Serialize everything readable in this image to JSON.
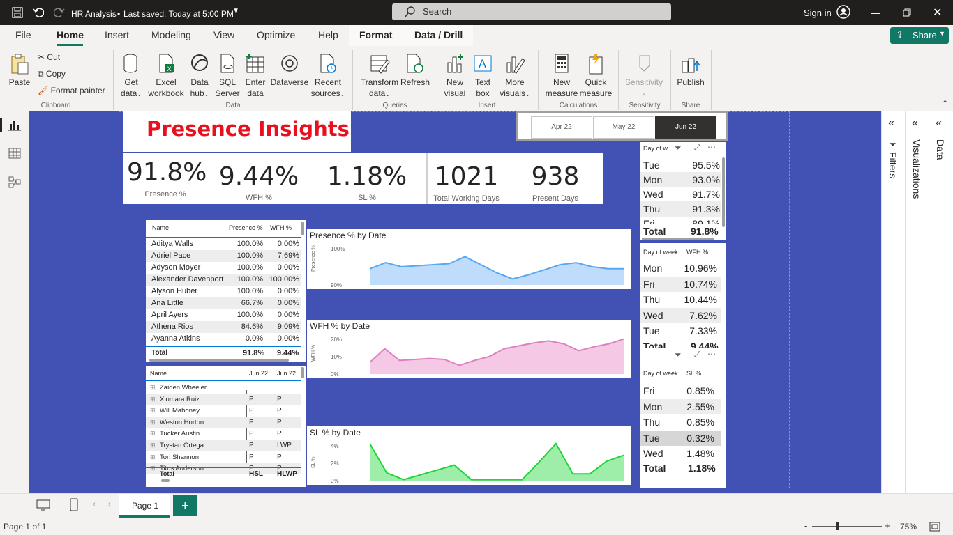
{
  "titlebar": {
    "doc_title": "HR Analysis",
    "saved_status": "Last saved: Today at 5:00 PM",
    "search_placeholder": "Search",
    "sign_in": "Sign in"
  },
  "menu": {
    "tabs": [
      "File",
      "Home",
      "Insert",
      "Modeling",
      "View",
      "Optimize",
      "Help",
      "Format",
      "Data / Drill"
    ],
    "active": "Home",
    "share": "Share"
  },
  "ribbon": {
    "clipboard": {
      "paste": "Paste",
      "cut": "Cut",
      "copy": "Copy",
      "format_painter": "Format painter",
      "group": "Clipboard"
    },
    "data": {
      "get_data": [
        "Get",
        "data"
      ],
      "excel": [
        "Excel",
        "workbook"
      ],
      "data_hub": [
        "Data",
        "hub"
      ],
      "sql": [
        "SQL",
        "Server"
      ],
      "enter": [
        "Enter",
        "data"
      ],
      "dataverse": "Dataverse",
      "recent": [
        "Recent",
        "sources"
      ],
      "group": "Data"
    },
    "queries": {
      "transform": [
        "Transform",
        "data"
      ],
      "refresh": "Refresh",
      "group": "Queries"
    },
    "insert": {
      "new_visual": [
        "New",
        "visual"
      ],
      "text_box": [
        "Text",
        "box"
      ],
      "more_visuals": [
        "More",
        "visuals"
      ],
      "group": "Insert"
    },
    "calculations": {
      "new_measure": [
        "New",
        "measure"
      ],
      "quick_measure": [
        "Quick",
        "measure"
      ],
      "group": "Calculations"
    },
    "sensitivity": {
      "label": "Sensitivity",
      "group": "Sensitivity"
    },
    "share": {
      "publish": "Publish",
      "group": "Share"
    }
  },
  "report": {
    "title": "Presence Insights",
    "slicer": {
      "items": [
        "Apr 22",
        "May 22",
        "Jun 22"
      ],
      "selected": "Jun 22"
    },
    "kpis": [
      {
        "value": "91.8%",
        "label": "Presence %"
      },
      {
        "value": "9.44%",
        "label": "WFH %"
      },
      {
        "value": "1.18%",
        "label": "SL %"
      },
      {
        "value": "1021",
        "label": "Total Working Days"
      },
      {
        "value": "938",
        "label": "Present Days"
      }
    ],
    "emp_table": {
      "headers": [
        "Name",
        "Presence %",
        "WFH %"
      ],
      "rows": [
        [
          "Aditya Walls",
          "100.0%",
          "0.00%"
        ],
        [
          "Adriel Pace",
          "100.0%",
          "7.69%"
        ],
        [
          "Adyson Moyer",
          "100.0%",
          "0.00%"
        ],
        [
          "Alexander Davenport",
          "100.0%",
          "100.00%"
        ],
        [
          "Alyson Huber",
          "100.0%",
          "0.00%"
        ],
        [
          "Ana Little",
          "66.7%",
          "0.00%"
        ],
        [
          "April Ayers",
          "100.0%",
          "0.00%"
        ],
        [
          "Athena Rios",
          "84.6%",
          "9.09%"
        ],
        [
          "Ayanna Atkins",
          "0.0%",
          "0.00%"
        ]
      ],
      "total": [
        "Total",
        "91.8%",
        "9.44%"
      ]
    },
    "matrix": {
      "headers": [
        "Name",
        "Jun 22",
        "Jun 22"
      ],
      "rows": [
        [
          "Zaiden Wheeler",
          "",
          ""
        ],
        [
          "Xiomara Ruiz",
          "P",
          "P"
        ],
        [
          "Will Mahoney",
          "P",
          "P"
        ],
        [
          "Weston Horton",
          "P",
          "P"
        ],
        [
          "Tucker Austin",
          "P",
          "P"
        ],
        [
          "Trystan Ortega",
          "P",
          "LWP"
        ],
        [
          "Tori Shannon",
          "P",
          "P"
        ],
        [
          "Titus Anderson",
          "P",
          "P"
        ]
      ],
      "total": [
        "Total",
        "HSL",
        "HLWP"
      ]
    },
    "dow_presence": {
      "headers": [
        "Day of w",
        "..."
      ],
      "rows": [
        [
          "Tue",
          "95.5%"
        ],
        [
          "Mon",
          "93.0%"
        ],
        [
          "Wed",
          "91.7%"
        ],
        [
          "Thu",
          "91.3%"
        ],
        [
          "Fri",
          "89.1%"
        ]
      ],
      "total": [
        "Total",
        "91.8%"
      ]
    },
    "dow_wfh": {
      "headers": [
        "Day of week",
        "WFH %"
      ],
      "rows": [
        [
          "Mon",
          "10.96%"
        ],
        [
          "Fri",
          "10.74%"
        ],
        [
          "Thu",
          "10.44%"
        ],
        [
          "Wed",
          "7.62%"
        ],
        [
          "Tue",
          "7.33%"
        ]
      ],
      "total": [
        "Total",
        "9.44%"
      ]
    },
    "dow_sl": {
      "headers": [
        "Day of week",
        "SL %"
      ],
      "rows": [
        [
          "Fri",
          "0.85%"
        ],
        [
          "Mon",
          "2.55%"
        ],
        [
          "Thu",
          "0.85%"
        ],
        [
          "Tue",
          "0.32%"
        ],
        [
          "Wed",
          "1.48%"
        ]
      ],
      "total": [
        "Total",
        "1.18%"
      ]
    }
  },
  "chart_data": [
    {
      "type": "area",
      "title": "Presence % by Date",
      "ylabel": "Presence %",
      "yticks": [
        "100%",
        "90%"
      ],
      "ylim": [
        82,
        102
      ],
      "values": [
        90,
        93,
        91,
        91.5,
        92,
        92.5,
        96,
        92,
        88,
        85,
        87,
        89.5,
        92,
        93,
        91,
        90,
        90
      ],
      "color": "#56a8f5",
      "fill": "#bfdcfb"
    },
    {
      "type": "area",
      "title": "WFH % by Date",
      "ylabel": "WFH %",
      "yticks": [
        "20%",
        "10%",
        "0%"
      ],
      "ylim": [
        0,
        20
      ],
      "values": [
        6,
        13,
        7,
        7.5,
        8,
        7.5,
        4.5,
        7,
        9,
        13,
        14.5,
        16,
        17,
        15.5,
        12,
        14,
        15.5,
        18
      ],
      "color": "#e07fc1",
      "fill": "#f5c9e5"
    },
    {
      "type": "area",
      "title": "SL % by Date",
      "ylabel": "SL %",
      "yticks": [
        "4%",
        "2%",
        "0%"
      ],
      "ylim": [
        0,
        4
      ],
      "values": [
        3.8,
        0.8,
        0.1,
        0.6,
        1.1,
        1.6,
        0.1,
        0.1,
        0.1,
        0.1,
        1.9,
        3.8,
        0.7,
        0.7,
        2,
        2.6
      ],
      "color": "#22d43a",
      "fill": "#9eeeaa"
    }
  ],
  "pages": {
    "tabs": [
      "Page 1"
    ],
    "status": "Page 1 of 1",
    "zoom": "75%"
  },
  "panes": {
    "filters": "Filters",
    "visualizations": "Visualizations",
    "data": "Data"
  },
  "colors": {
    "canvas": "#4151b4",
    "title_red": "#e8101e",
    "accent_green": "#117865",
    "brand_dark": "#201f1e"
  }
}
